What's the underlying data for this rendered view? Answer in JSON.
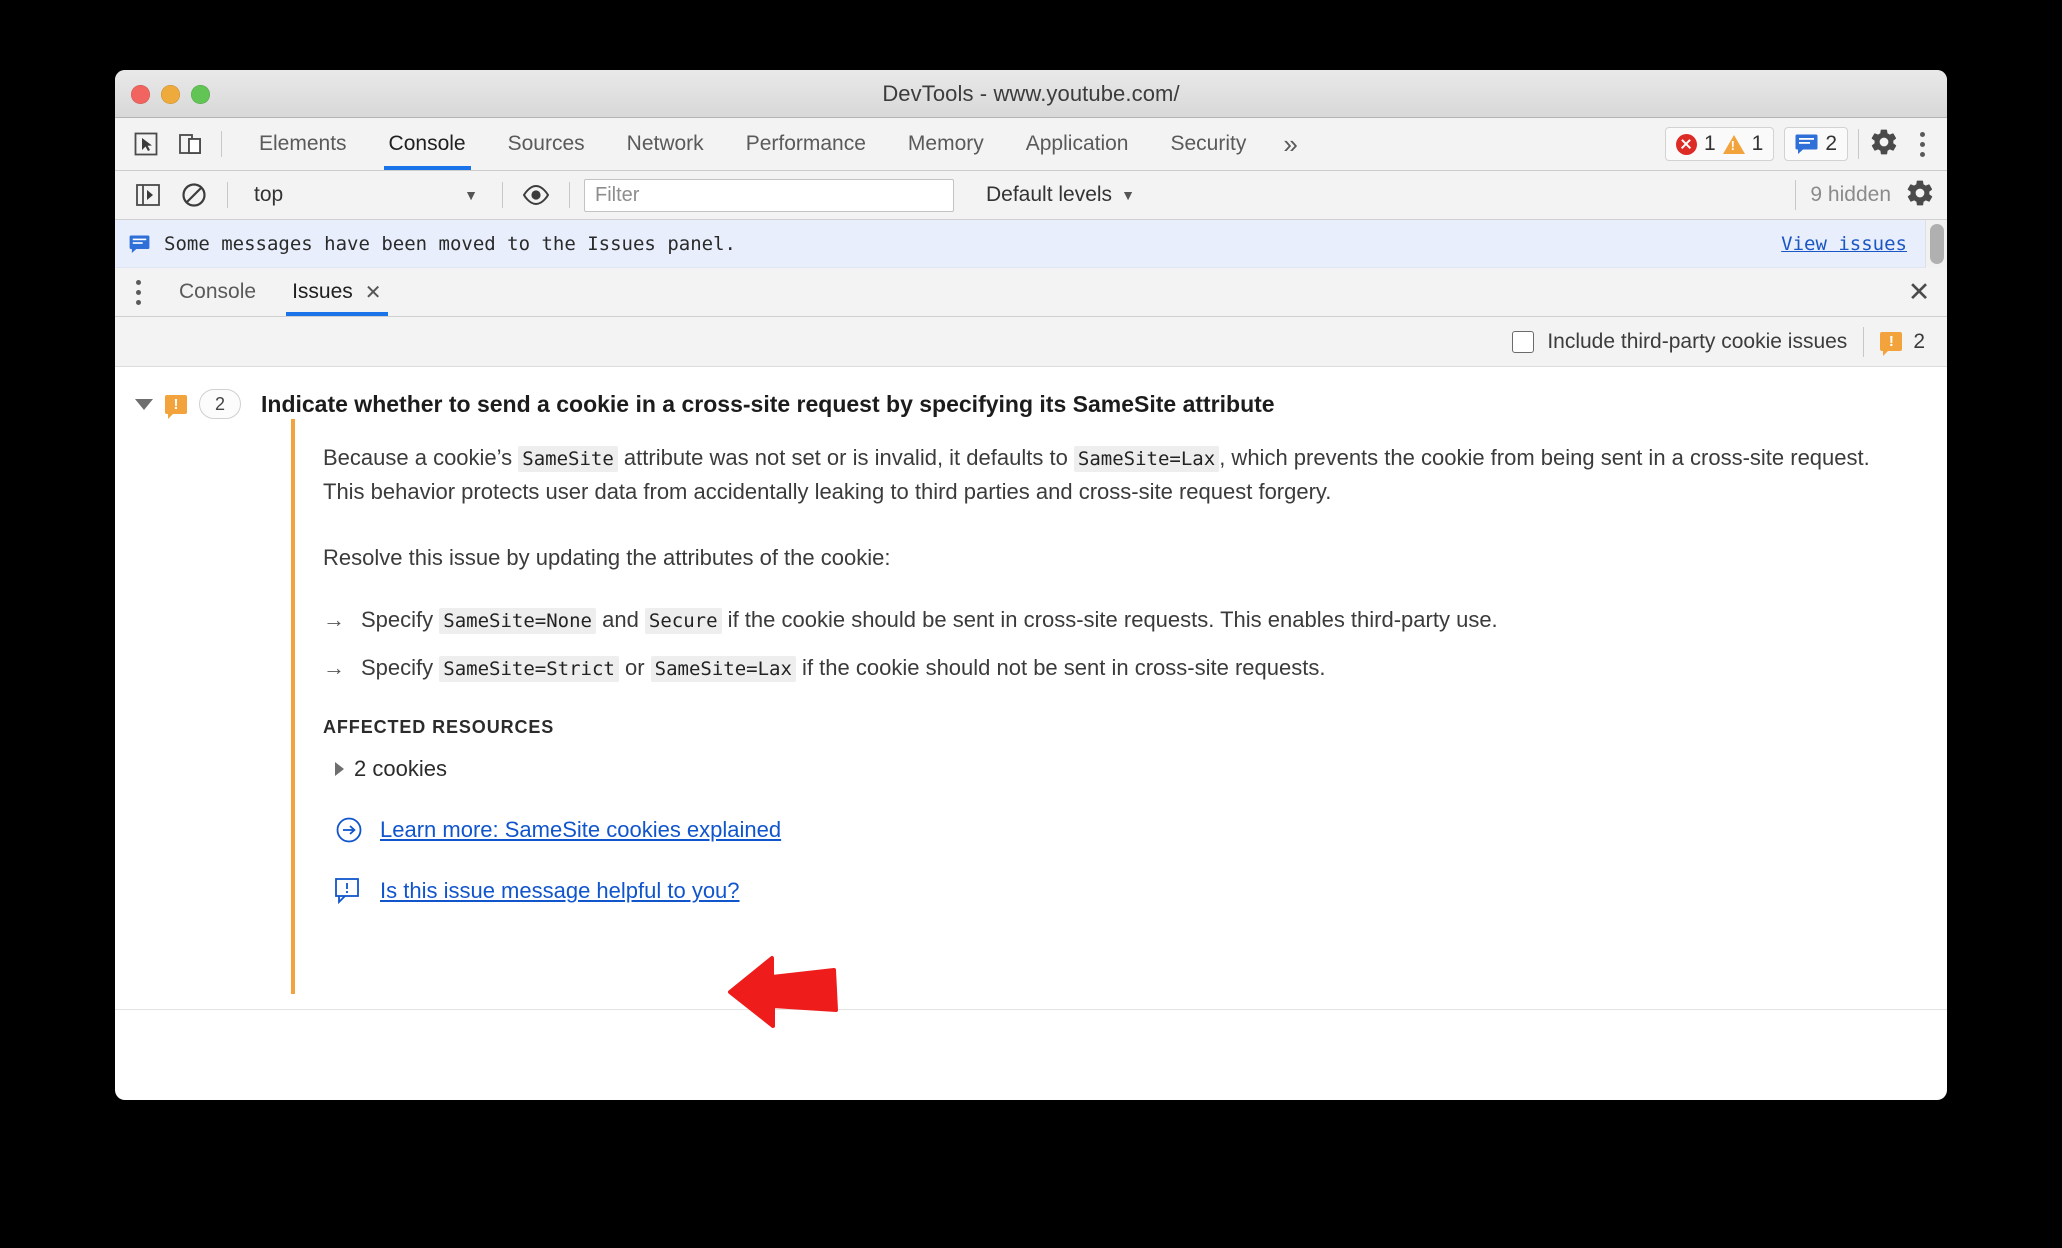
{
  "window": {
    "title": "DevTools - www.youtube.com/",
    "traffic_lights": [
      "close",
      "minimize",
      "maximize"
    ]
  },
  "main_tabbar": {
    "left_icons": [
      "inspect-element-icon",
      "device-toolbar-icon"
    ],
    "tabs": [
      {
        "label": "Elements",
        "active": false
      },
      {
        "label": "Console",
        "active": true
      },
      {
        "label": "Sources",
        "active": false
      },
      {
        "label": "Network",
        "active": false
      },
      {
        "label": "Performance",
        "active": false
      },
      {
        "label": "Memory",
        "active": false
      },
      {
        "label": "Application",
        "active": false
      },
      {
        "label": "Security",
        "active": false
      }
    ],
    "more_tabs_label": "»",
    "error_count": "1",
    "warning_count": "1",
    "issue_count": "2"
  },
  "console_toolbar": {
    "context_value": "top",
    "context_caret": "▼",
    "filter_placeholder": "Filter",
    "filter_value": "",
    "levels_label": "Default levels",
    "levels_caret": "▼",
    "hidden_label": "9 hidden"
  },
  "console_banner": {
    "message": "Some messages have been moved to the Issues panel.",
    "action_link": "View issues"
  },
  "drawer": {
    "tabs": [
      {
        "label": "Console",
        "active": false,
        "closable": false
      },
      {
        "label": "Issues",
        "active": true,
        "closable": true
      }
    ],
    "close_glyph": "✕",
    "tab_close_glyph": "✕"
  },
  "issues_toolbar": {
    "checkbox_label": "Include third-party cookie issues",
    "checkbox_checked": false,
    "count": "2"
  },
  "issue": {
    "badge_count": "2",
    "title": "Indicate whether to send a cookie in a cross-site request by specifying its SameSite attribute",
    "paragraph1_a": "Because a cookie’s ",
    "paragraph1_code1": "SameSite",
    "paragraph1_b": " attribute was not set or is invalid, it defaults to ",
    "paragraph1_code2": "SameSite=Lax",
    "paragraph1_c": ", which prevents the cookie from being sent in a cross-site request. This behavior protects user data from accidentally leaking to third parties and cross-site request forgery.",
    "paragraph2": "Resolve this issue by updating the attributes of the cookie:",
    "bullet1_arrow": "→",
    "bullet1_a": "Specify ",
    "bullet1_code1": "SameSite=None",
    "bullet1_b": " and ",
    "bullet1_code2": "Secure",
    "bullet1_c": " if the cookie should be sent in cross-site requests. This enables third-party use.",
    "bullet2_arrow": "→",
    "bullet2_a": "Specify ",
    "bullet2_code1": "SameSite=Strict",
    "bullet2_b": " or ",
    "bullet2_code2": "SameSite=Lax",
    "bullet2_c": " if the cookie should not be sent in cross-site requests.",
    "affected_label": "AFFECTED RESOURCES",
    "resource_label": "2 cookies",
    "learn_more_link": "Learn more: SameSite cookies explained",
    "feedback_link": "Is this issue message helpful to you?"
  },
  "colors": {
    "accent_blue": "#1a73e8",
    "link_blue": "#1155cc",
    "warning_orange": "#f2a33c",
    "error_red": "#dd2c25",
    "annotation_red": "#ef1c1c"
  }
}
